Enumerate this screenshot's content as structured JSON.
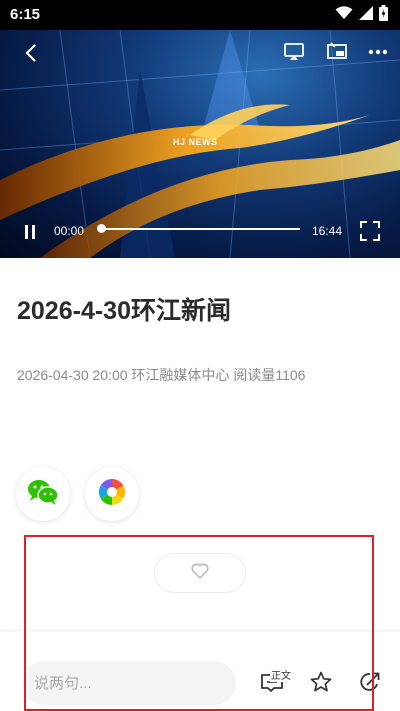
{
  "status_bar": {
    "time": "6:15",
    "icons": [
      "wifi-icon",
      "signal-icon",
      "battery-icon"
    ]
  },
  "video": {
    "logo_text": "HJ NEWS",
    "current_time": "00:00",
    "duration": "16:44",
    "progress": 0.0,
    "icons": [
      "back-icon",
      "airplay-icon",
      "pip-icon",
      "more-icon",
      "pause-icon",
      "fullscreen-icon"
    ]
  },
  "article": {
    "title": "2026-4-30环江新闻",
    "meta": "2026-04-30 20:00 环江融媒体中心 阅读量1106"
  },
  "share": {
    "items": [
      "wechat-icon",
      "moments-icon"
    ]
  },
  "like": {
    "icon": "heart-icon"
  },
  "bottom_bar": {
    "comment_placeholder": "说两句...",
    "zhengwen_label": "正文",
    "icons": [
      "comment-icon",
      "star-icon",
      "share-icon"
    ]
  },
  "colors": {
    "highlight": "#d9212c",
    "video_gold": "#f2a21a",
    "wechat_green": "#2dc100"
  }
}
